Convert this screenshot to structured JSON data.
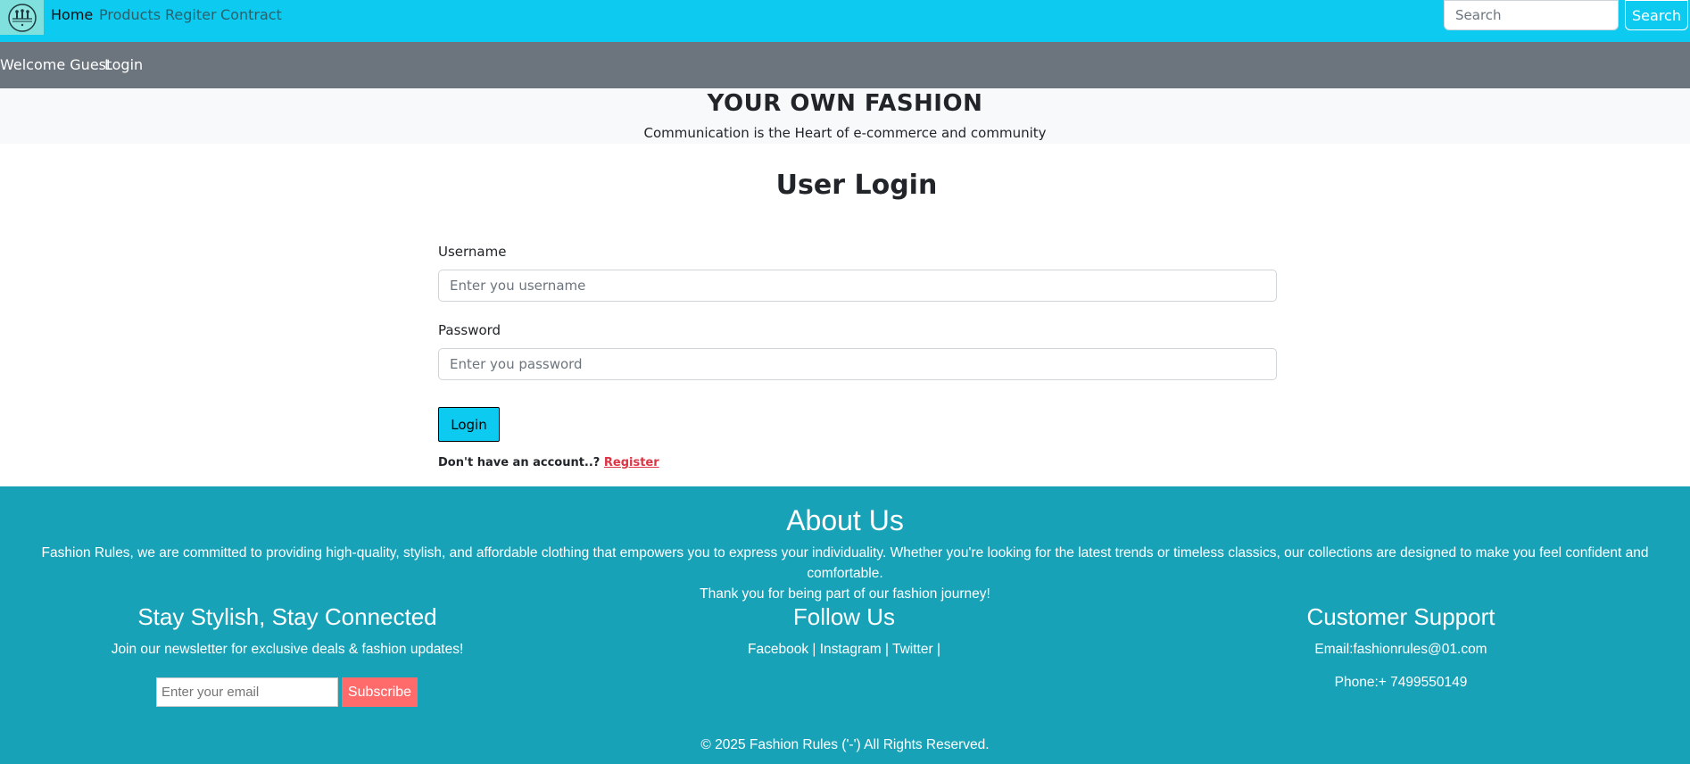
{
  "nav": {
    "home": "Home",
    "products": "Products",
    "register": "Regiter",
    "contract": "Contract",
    "search_placeholder": "Search",
    "search_button": "Search"
  },
  "subbar": {
    "welcome": "Welcome Guest",
    "login": "Login"
  },
  "banner": {
    "title": "YOUR OWN FASHION",
    "subtitle": "Communication is the Heart of e-commerce and community"
  },
  "login": {
    "title": "User Login",
    "username_label": "Username",
    "username_placeholder": "Enter you username",
    "password_label": "Password",
    "password_placeholder": "Enter you password",
    "button": "Login",
    "account_prompt": "Don't have an account..? ",
    "register_link": "Register"
  },
  "footer": {
    "about_title": "About Us",
    "about_line1": "Fashion Rules, we are committed to providing high-quality, stylish, and affordable clothing that empowers you to express your individuality. Whether you're looking for the latest trends or timeless classics, our collections are designed to make you feel confident and comfortable.",
    "about_line2": "Thank you for being part of our fashion journey!",
    "newsletter_title": "Stay Stylish, Stay Connected",
    "newsletter_text": "Join our newsletter for exclusive deals & fashion updates!",
    "email_placeholder": "Enter your email",
    "subscribe_button": "Subscribe",
    "follow_title": "Follow Us",
    "follow_links": "Facebook | Instagram | Twitter |",
    "support_title": "Customer Support",
    "support_email": "Email:fashionrules@01.com",
    "support_phone": "Phone:+ 7499550149",
    "copyright": "© 2025 Fashion Rules ('-') All Rights Reserved."
  },
  "colors": {
    "navbar": "#0dcaf0",
    "subbar": "#6c757d",
    "banner": "#f8f9fa",
    "footer": "#17a2b8",
    "subscribe": "#ff6b6b",
    "register_link": "#dc3545"
  },
  "icons": {
    "logo": "fashion-logo-icon"
  }
}
